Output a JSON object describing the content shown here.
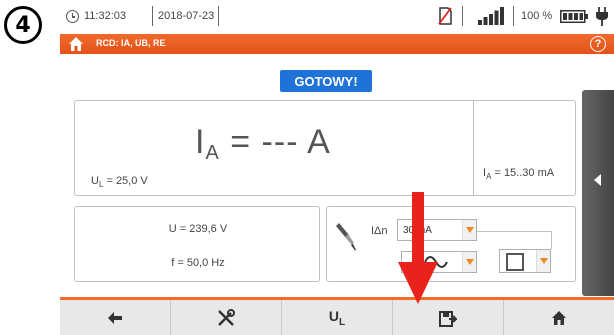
{
  "step_number": "4",
  "status_bar": {
    "time": "11:32:03",
    "date": "2018-07-23",
    "battery_percent": "100 %"
  },
  "title_bar": {
    "title": "RCD: IA, UB, RE"
  },
  "status_label": "GOTOWY!",
  "result": {
    "ia_prefix": "I",
    "ia_sub": "A",
    "ia_value": " = --- A",
    "ul_prefix": "U",
    "ul_sub": "L",
    "ul_value": " = 25,0 V",
    "range_prefix": "I",
    "range_sub": "A",
    "range_value": " = 15..30 mA"
  },
  "measurements": {
    "voltage": "U = 239,6 V",
    "frequency": "f = 50,0 Hz"
  },
  "settings": {
    "idn_label": "IΔn",
    "idn_value": "30 mA"
  },
  "bottom_bar": {
    "ul_button_main": "U",
    "ul_button_sub": "L"
  },
  "colors": {
    "accent_orange": "#f26b2b",
    "status_blue": "#1f73d8",
    "arrow_red": "#e8231b"
  }
}
